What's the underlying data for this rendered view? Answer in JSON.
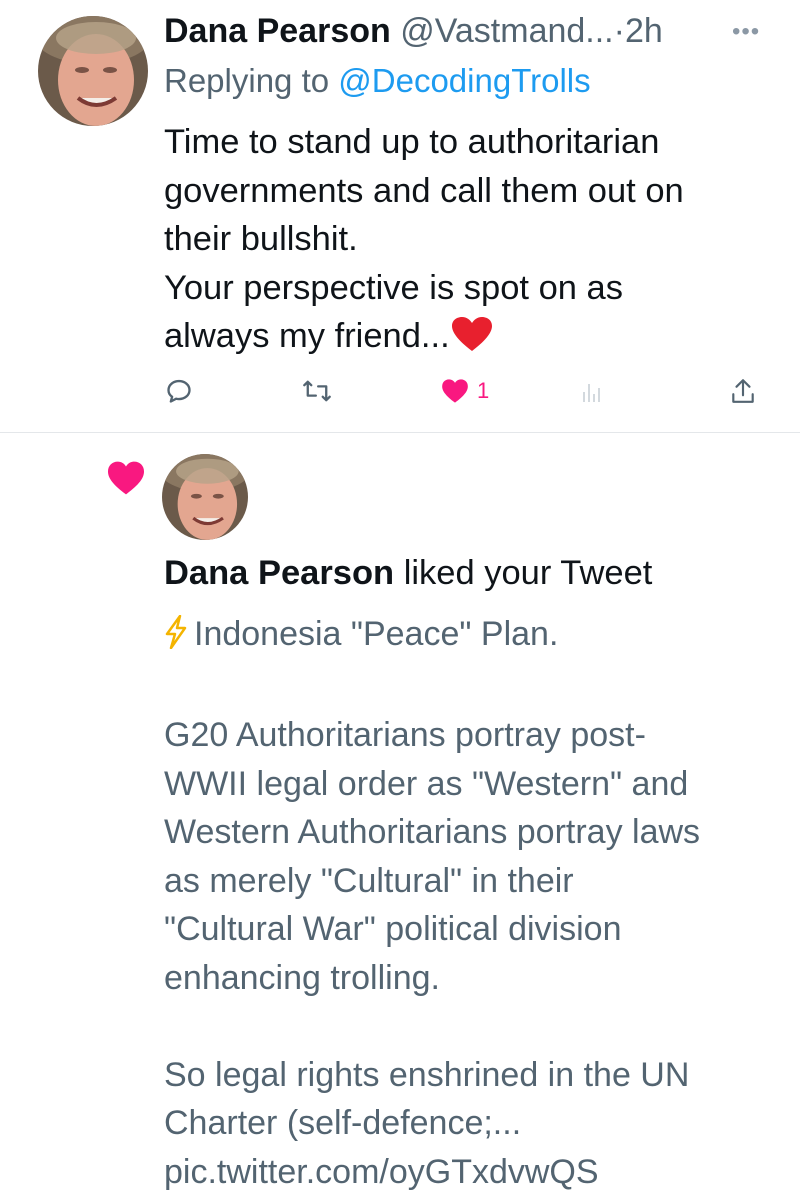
{
  "reply": {
    "author_name": "Dana Pearson",
    "handle": "@Vastmand...",
    "separator": "·",
    "time": "2h",
    "more_icon": "more-horizontal-icon",
    "replying_prefix": "Replying to ",
    "replying_to": "@DecodingTrolls",
    "text_lines": [
      "Time to stand up to authoritarian",
      "governments and call them out on",
      "their bullshit.",
      "Your perspective is spot on as",
      "always my friend..."
    ],
    "text_emoji": "heart-emoji",
    "actions": {
      "reply_icon": "reply-icon",
      "retweet_icon": "retweet-icon",
      "like_icon": "heart-filled-icon",
      "like_count": "1",
      "views_icon": "analytics-icon",
      "share_icon": "share-icon"
    }
  },
  "notification": {
    "icon": "heart-filled-icon",
    "liker_name": "Dana Pearson",
    "action_text": " liked your Tweet",
    "quoted_lines": [
      "Indonesia \"Peace\" Plan.",
      "",
      "G20 Authoritarians portray post-",
      "WWII legal order as \"Western\" and",
      "Western Authoritarians portray laws",
      "as merely \"Cultural\" in their",
      "\"Cultural War\" political division",
      "enhancing trolling.",
      "",
      "So legal rights enshrined in the UN",
      "Charter (self-defence;...",
      "pic.twitter.com/oyGTxdvwQS"
    ],
    "quoted_emoji": "lightning-emoji"
  },
  "colors": {
    "accent": "#1d9bf0",
    "like_pink": "#f91880",
    "muted_text": "#536471",
    "divider": "#e4e7ea"
  }
}
